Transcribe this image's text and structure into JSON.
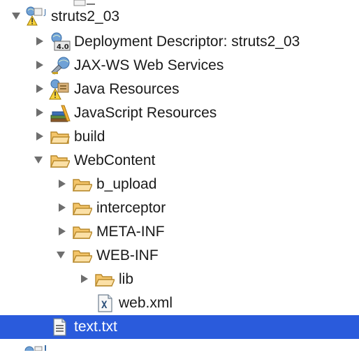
{
  "tree": {
    "project": {
      "label": "struts2_03",
      "icon": "dynamic-web-project-warning-icon"
    },
    "items": [
      {
        "label": "Deployment Descriptor: struts2_03",
        "icon": "deployment-descriptor-icon"
      },
      {
        "label": "JAX-WS Web Services",
        "icon": "web-services-icon"
      },
      {
        "label": "Java Resources",
        "icon": "java-resources-warning-icon"
      },
      {
        "label": "JavaScript Resources",
        "icon": "javascript-resources-icon"
      },
      {
        "label": "build",
        "icon": "folder-icon"
      },
      {
        "label": "WebContent",
        "icon": "open-folder-icon"
      },
      {
        "label": "b_upload",
        "icon": "open-folder-icon"
      },
      {
        "label": "interceptor",
        "icon": "open-folder-icon"
      },
      {
        "label": "META-INF",
        "icon": "open-folder-icon"
      },
      {
        "label": "WEB-INF",
        "icon": "open-folder-icon"
      },
      {
        "label": "lib",
        "icon": "open-folder-icon"
      },
      {
        "label": "web.xml",
        "icon": "xml-file-icon"
      },
      {
        "label": "text.txt",
        "icon": "text-file-icon",
        "selected": true
      }
    ]
  },
  "colors": {
    "selection": "#2a5bdc",
    "folder": "#f4c56a",
    "folder_stroke": "#b8892c"
  }
}
